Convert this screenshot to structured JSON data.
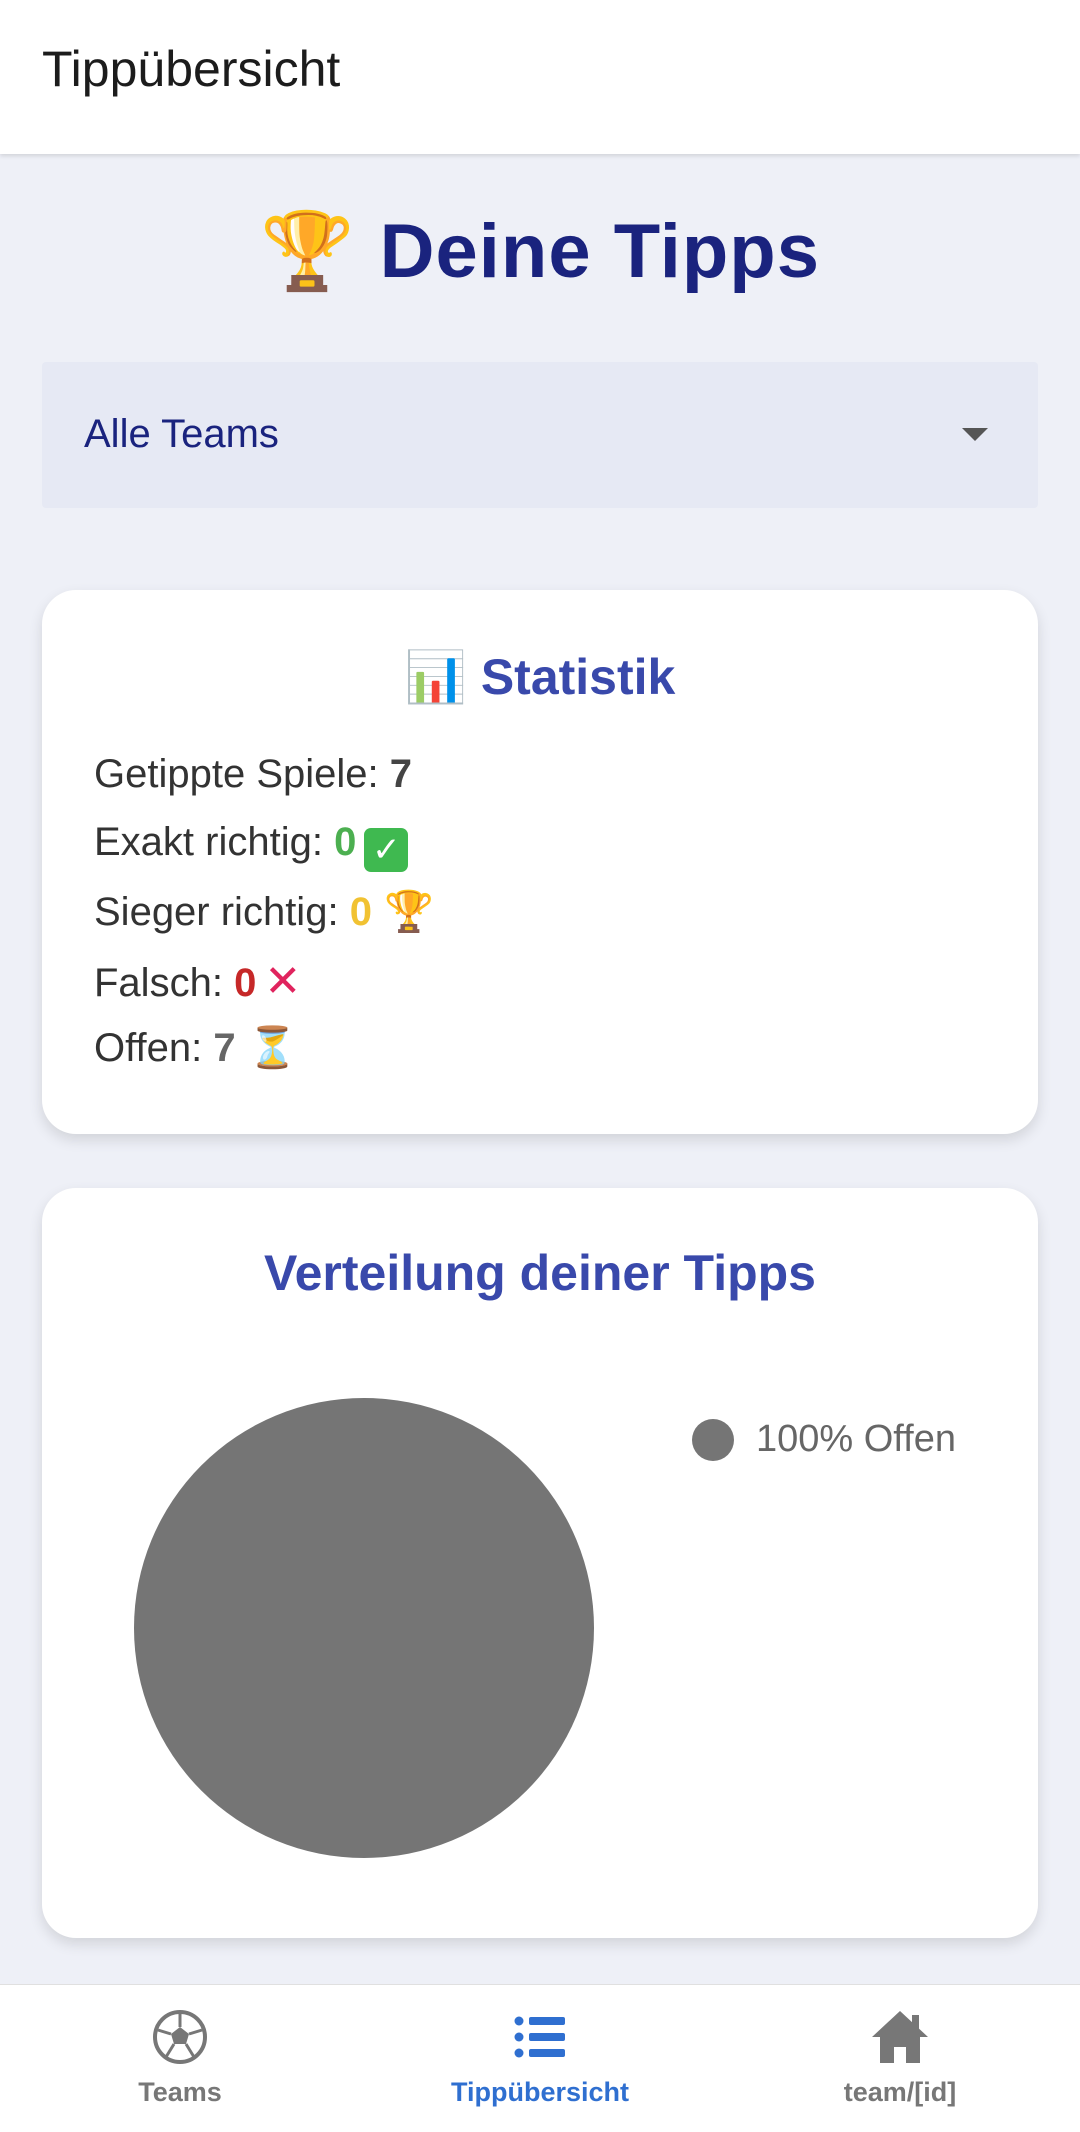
{
  "appbar": {
    "title": "Tippübersicht"
  },
  "heading": {
    "emoji": "🏆",
    "text": "Deine Tipps"
  },
  "filter": {
    "selected": "Alle Teams"
  },
  "stats": {
    "title_emoji": "📊",
    "title": "Statistik",
    "lines": [
      {
        "label": "Getippte Spiele:",
        "value": "7",
        "suffix": ""
      },
      {
        "label": "Exakt richtig:",
        "value": "0",
        "suffix": "✓"
      },
      {
        "label": "Sieger richtig:",
        "value": "0",
        "suffix": "🏆"
      },
      {
        "label": "Falsch:",
        "value": "0",
        "suffix": "✕"
      },
      {
        "label": "Offen:",
        "value": "7",
        "suffix": "⏳"
      }
    ]
  },
  "distribution": {
    "title": "Verteilung deiner Tipps",
    "legend_label": "100% Offen"
  },
  "chart_data": {
    "type": "pie",
    "title": "Verteilung deiner Tipps",
    "slices": [
      {
        "name": "Offen",
        "value": 100,
        "color": "#757575"
      }
    ],
    "legend": [
      "100% Offen"
    ],
    "legend_position": "right"
  },
  "colors": {
    "primary": "#1a237e",
    "accent": "#3949ab",
    "active_nav": "#2f6fd0",
    "correct": "#4caf50",
    "winner": "#f1c232",
    "wrong": "#c62828",
    "open": "#757575"
  },
  "bottom_nav": {
    "items": [
      {
        "label": "Teams",
        "icon": "soccer-ball-icon",
        "active": false
      },
      {
        "label": "Tippübersicht",
        "icon": "list-icon",
        "active": true
      },
      {
        "label": "team/[id]",
        "icon": "home-icon",
        "active": false
      }
    ]
  }
}
